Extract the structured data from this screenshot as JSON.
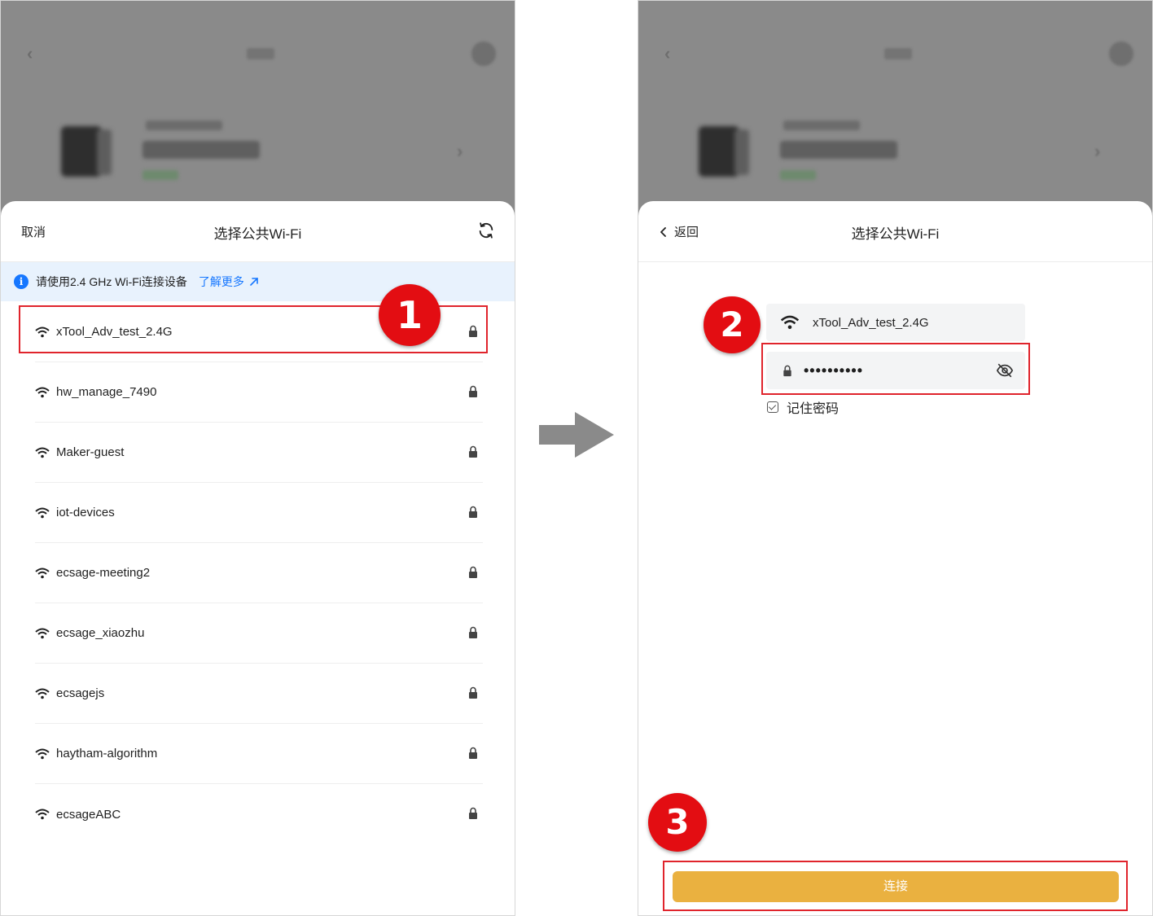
{
  "left_panel": {
    "header": {
      "cancel_label": "取消",
      "title": "选择公共Wi-Fi",
      "refresh_icon": "refresh-icon"
    },
    "notice": {
      "info_icon_glyph": "i",
      "text": "请使用2.4 GHz Wi-Fi连接设备",
      "link_label": "了解更多"
    },
    "networks": [
      {
        "name": "xTool_Adv_test_2.4G",
        "locked": true
      },
      {
        "name": "hw_manage_7490",
        "locked": true
      },
      {
        "name": "Maker-guest",
        "locked": true
      },
      {
        "name": "iot-devices",
        "locked": true
      },
      {
        "name": "ecsage-meeting2",
        "locked": true
      },
      {
        "name": "ecsage_xiaozhu",
        "locked": true
      },
      {
        "name": "ecsagejs",
        "locked": true
      },
      {
        "name": "haytham-algorithm",
        "locked": true
      },
      {
        "name": "ecsageABC",
        "locked": true
      }
    ],
    "step_badge": "1"
  },
  "right_panel": {
    "header": {
      "back_label": "返回",
      "title": "选择公共Wi-Fi"
    },
    "selected_network": "xTool_Adv_test_2.4G",
    "password_masked": "••••••••••",
    "remember_label": "记住密码",
    "connect_label": "连接",
    "step_badges": [
      "2",
      "3"
    ]
  },
  "colors": {
    "accent_blue": "#1677ff",
    "connect_button": "#eab140",
    "annotation_red": "#e0242c",
    "notice_background": "#e8f2fd"
  }
}
